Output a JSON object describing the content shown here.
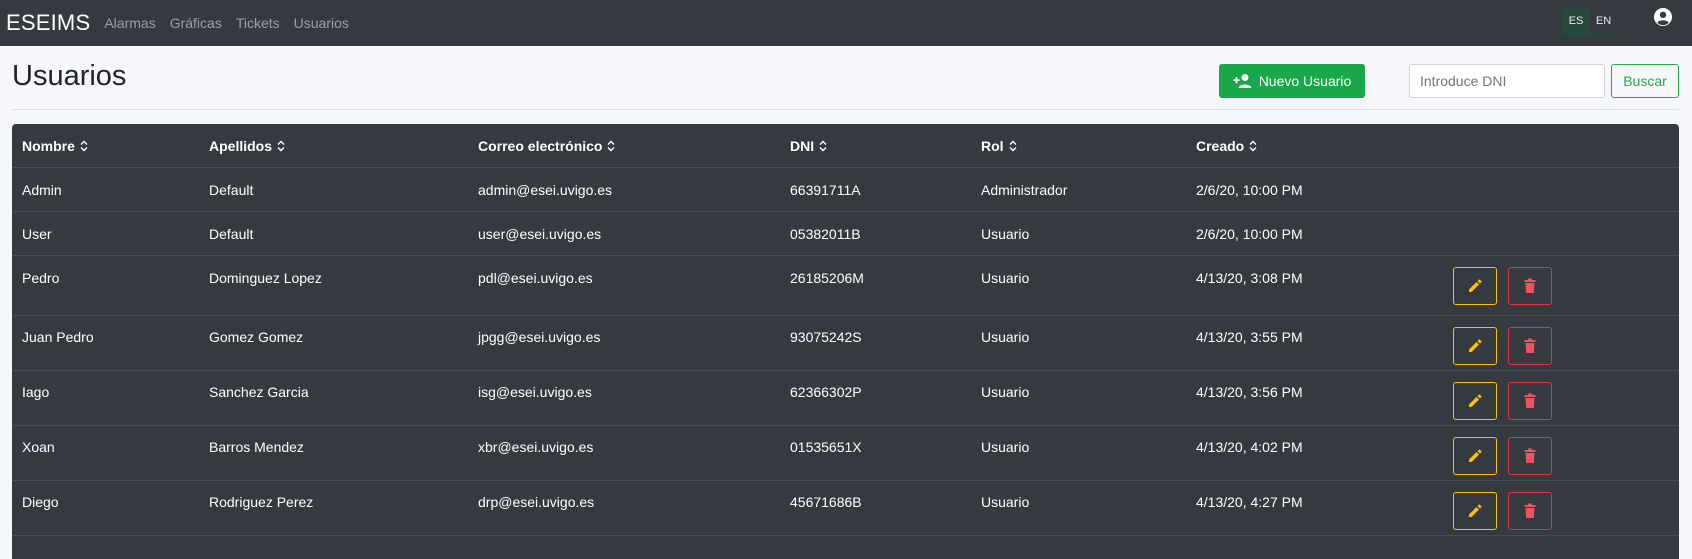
{
  "navbar": {
    "brand": "ESEIMS",
    "links": [
      "Alarmas",
      "Gráficas",
      "Tickets",
      "Usuarios"
    ],
    "languages": [
      "ES",
      "EN"
    ],
    "active_language": "ES"
  },
  "page": {
    "title": "Usuarios",
    "new_user_label": "Nuevo Usuario",
    "search_placeholder": "Introduce DNI",
    "search_value": "",
    "search_label": "Buscar"
  },
  "table": {
    "columns": [
      "Nombre",
      "Apellidos",
      "Correo electrónico",
      "DNI",
      "Rol",
      "Creado"
    ],
    "rows": [
      {
        "nombre": "Admin",
        "apellidos": "Default",
        "correo": "admin@esei.uvigo.es",
        "dni": "66391711A",
        "rol": "Administrador",
        "creado": "2/6/20, 10:00 PM",
        "actions": false
      },
      {
        "nombre": "User",
        "apellidos": "Default",
        "correo": "user@esei.uvigo.es",
        "dni": "05382011B",
        "rol": "Usuario",
        "creado": "2/6/20, 10:00 PM",
        "actions": false
      },
      {
        "nombre": "Pedro",
        "apellidos": "Dominguez Lopez",
        "correo": "pdl@esei.uvigo.es",
        "dni": "26185206M",
        "rol": "Usuario",
        "creado": "4/13/20, 3:08 PM",
        "actions": true
      },
      {
        "nombre": "Juan Pedro",
        "apellidos": "Gomez Gomez",
        "correo": "jpgg@esei.uvigo.es",
        "dni": "93075242S",
        "rol": "Usuario",
        "creado": "4/13/20, 3:55 PM",
        "actions": true
      },
      {
        "nombre": "Iago",
        "apellidos": "Sanchez Garcia",
        "correo": "isg@esei.uvigo.es",
        "dni": "62366302P",
        "rol": "Usuario",
        "creado": "4/13/20, 3:56 PM",
        "actions": true
      },
      {
        "nombre": "Xoan",
        "apellidos": "Barros Mendez",
        "correo": "xbr@esei.uvigo.es",
        "dni": "01535651X",
        "rol": "Usuario",
        "creado": "4/13/20, 4:02 PM",
        "actions": true
      },
      {
        "nombre": "Diego",
        "apellidos": "Rodriguez Perez",
        "correo": "drp@esei.uvigo.es",
        "dni": "45671686B",
        "rol": "Usuario",
        "creado": "4/13/20, 4:27 PM",
        "actions": true
      }
    ]
  },
  "icons": {
    "user": "user-circle-icon",
    "new_user": "add-user-icon",
    "sort": "sort-icon",
    "edit": "pencil-icon",
    "delete": "trash-icon"
  },
  "colors": {
    "navbar_bg": "#343a40",
    "table_bg": "#343a40",
    "primary_action": "#18a84a",
    "edit_accent": "#ffc107",
    "delete_accent": "#dc3545"
  }
}
